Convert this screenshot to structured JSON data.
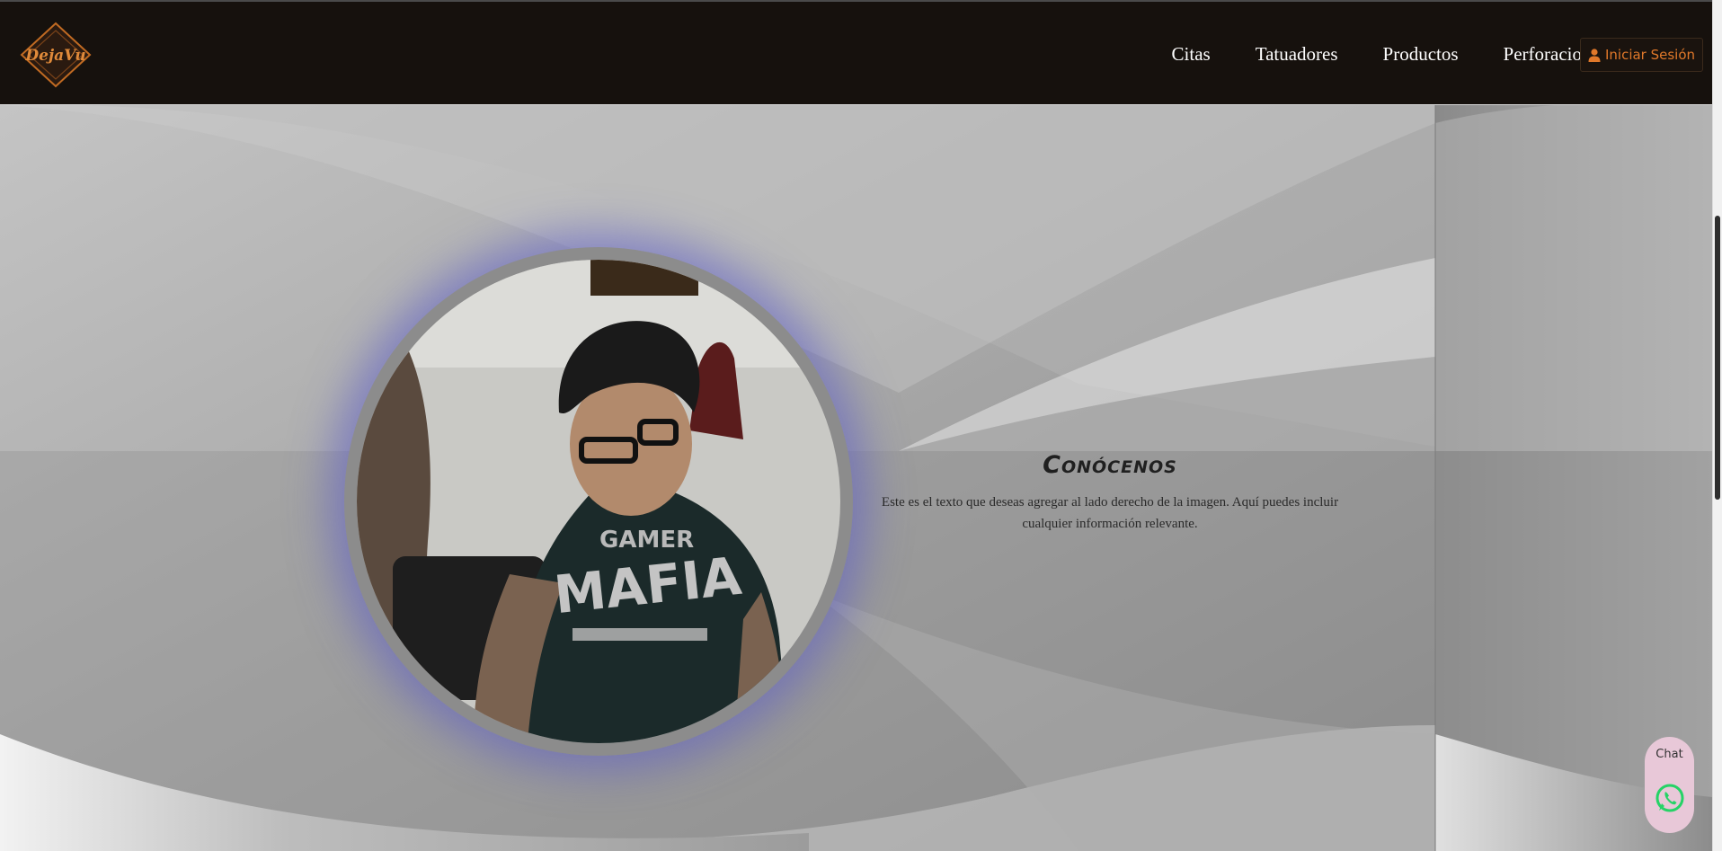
{
  "brand": {
    "logo_text": "DejaVu"
  },
  "nav": {
    "links": [
      "Citas",
      "Tatuadores",
      "Productos",
      "Perforaciones"
    ],
    "login_label": "Iniciar Sesión"
  },
  "about": {
    "title": "Conócenos",
    "text": "Este es el texto que deseas agregar al lado derecho de la imagen. Aquí puedes incluir cualquier información relevante.",
    "photo_shirt_text_top": "GAMER",
    "photo_shirt_text_main": "MAFIA"
  },
  "chat": {
    "label": "Chat"
  },
  "colors": {
    "nav_bg": "#16110d",
    "accent": "#e0782a",
    "ring_glow": "#5a5ac8",
    "whatsapp": "#25d366"
  },
  "icons": [
    "user-icon",
    "whatsapp-icon"
  ]
}
